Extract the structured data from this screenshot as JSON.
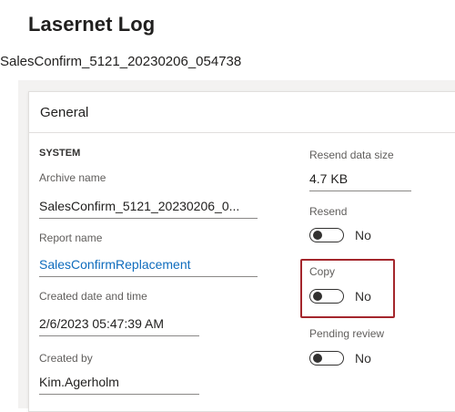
{
  "page": {
    "title": "Lasernet Log",
    "record_id": "SalesConfirm_5121_20230206_054738"
  },
  "card": {
    "title": "General",
    "system_group": "SYSTEM",
    "fields": {
      "archive_name": {
        "label": "Archive name",
        "value": "SalesConfirm_5121_20230206_0..."
      },
      "report_name": {
        "label": "Report name",
        "value": "SalesConfirmReplacement"
      },
      "created": {
        "label": "Created date and time",
        "value": "2/6/2023 05:47:39 AM"
      },
      "created_by": {
        "label": "Created by",
        "value": "Kim.Agerholm"
      },
      "resend_size": {
        "label": "Resend data size",
        "value": "4.7 KB"
      }
    },
    "toggles": {
      "resend": {
        "label": "Resend",
        "state": "No"
      },
      "copy": {
        "label": "Copy",
        "state": "No"
      },
      "pending": {
        "label": "Pending review",
        "state": "No"
      }
    }
  },
  "colors": {
    "link": "#0f6cbd",
    "highlight": "#a4262c"
  }
}
